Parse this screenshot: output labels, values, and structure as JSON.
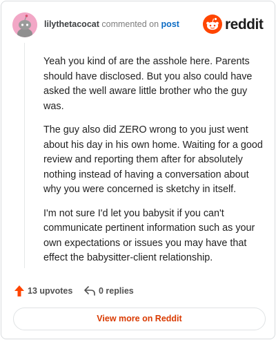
{
  "header": {
    "username": "lilythetacocat",
    "action_text": "commented on",
    "post_link": "post",
    "brand_name": "reddit"
  },
  "comment": {
    "paragraphs": [
      "Yeah you kind of are the asshole here. Parents should have disclosed. But you also could have asked the well aware little brother who the guy was.",
      "The guy also did ZERO wrong to you just went about his day in his own home. Waiting for a good review and reporting them after for absolutely nothing instead of having a conversation about why you were concerned is sketchy in itself.",
      "I'm not sure I'd let you babysit if you can't communicate pertinent information such as your own expectations or issues you may have that effect the babysitter-client relationship."
    ]
  },
  "actions": {
    "upvotes_label": "13 upvotes",
    "replies_label": "0 replies"
  },
  "footer": {
    "view_more_label": "View more on Reddit"
  },
  "colors": {
    "brand": "#ff4500",
    "link": "#0b6bc4",
    "view_more_text": "#d93a00",
    "avatar_bg": "#f2a7c6"
  },
  "icons": {
    "avatar": "snoo-avatar-icon",
    "logo": "reddit-snoo-icon",
    "upvote": "upvote-arrow-icon",
    "reply": "reply-arrow-icon"
  }
}
